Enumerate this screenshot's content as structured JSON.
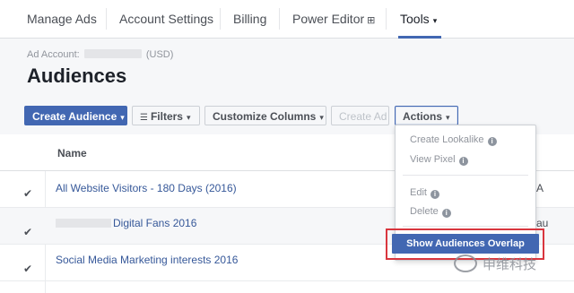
{
  "nav": {
    "items": [
      {
        "label": "Manage Ads"
      },
      {
        "label": "Account Settings"
      },
      {
        "label": "Billing"
      },
      {
        "label": "Power Editor",
        "icon": "external-link-icon",
        "glyph": "⊞"
      },
      {
        "label": "Tools",
        "active": true
      }
    ],
    "caret_glyph": "▾"
  },
  "header": {
    "account_prefix": "Ad Account:",
    "account_suffix": "(USD)",
    "title": "Audiences"
  },
  "toolbar": {
    "create_audience": "Create Audience",
    "filters": "Filters",
    "customize_columns": "Customize Columns",
    "create_ad": "Create Ad",
    "actions": "Actions",
    "caret": "▾",
    "filter_glyph": "☰"
  },
  "table": {
    "header_name": "Name",
    "check_glyph": "✔",
    "rows": [
      {
        "name": "All Website Visitors - 180 Days (2016)",
        "edge": "A"
      },
      {
        "name": "Digital Fans 2016",
        "masked_prefix": true,
        "edge": "au"
      },
      {
        "name": "Social Media Marketing interests 2016",
        "edge": ""
      }
    ]
  },
  "dropdown": {
    "items": [
      {
        "label": "Create Lookalike",
        "info": true
      },
      {
        "label": "View Pixel",
        "info": true
      },
      {
        "label": "Edit",
        "info": true
      },
      {
        "label": "Delete",
        "info": true
      }
    ],
    "info_glyph": "i",
    "highlight": "Show Audiences Overlap"
  },
  "watermark": {
    "text": "申维科技"
  },
  "colors": {
    "accent": "#4267b2",
    "highlight_frame": "#d9363e"
  }
}
